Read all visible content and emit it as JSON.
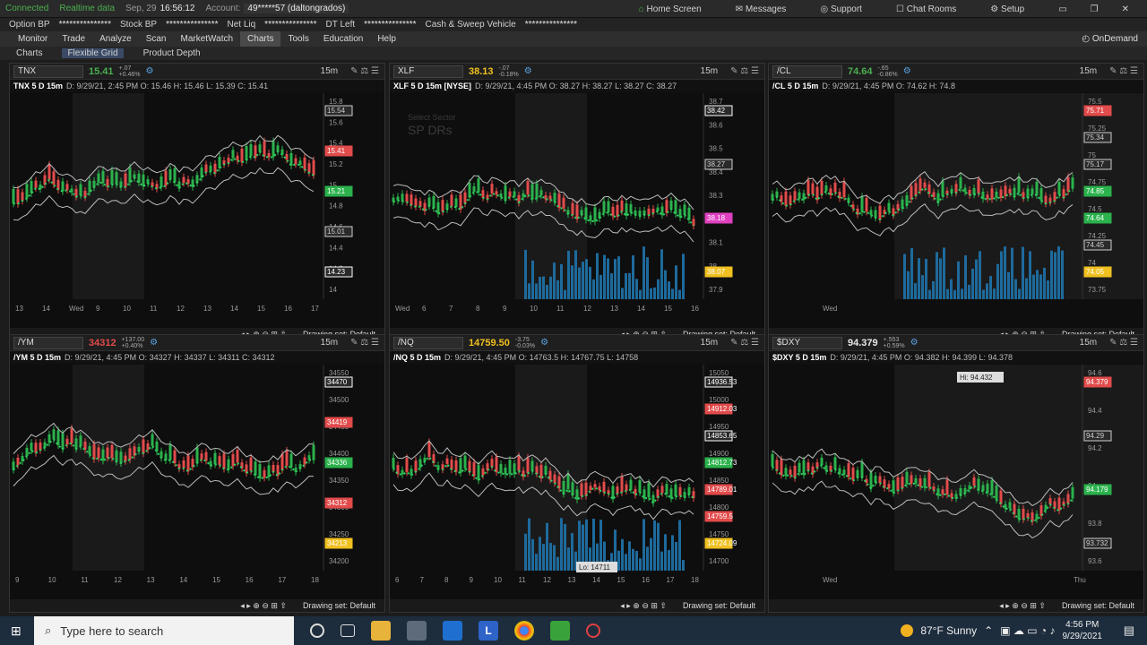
{
  "topbar": {
    "connected": "Connected",
    "realtime": "Realtime data",
    "date": "Sep, 29",
    "time": "16:56:12",
    "account_label": "Account:",
    "account": "49*****57 (daltongrados)",
    "home": "Home Screen",
    "messages": "Messages",
    "support": "Support",
    "chat": "Chat Rooms",
    "setup": "Setup"
  },
  "infobar": {
    "option_bp": "Option BP",
    "option_val": "***************",
    "stock_bp": "Stock BP",
    "stock_val": "***************",
    "net_liq": "Net Liq",
    "net_val": "***************",
    "dt_left": "DT Left",
    "dt_val": "***************",
    "sweep": "Cash & Sweep Vehicle",
    "sweep_val": "***************"
  },
  "nav": [
    "Monitor",
    "Trade",
    "Analyze",
    "Scan",
    "MarketWatch",
    "Charts",
    "Tools",
    "Education",
    "Help"
  ],
  "ondemand": "OnDemand",
  "subnav": [
    "Charts",
    "Flexible Grid",
    "Product Depth"
  ],
  "panels": [
    {
      "symbol": "TNX",
      "price": "15.41",
      "price_color": "#4caf50",
      "chg1": "+.07",
      "chg2": "+0.46%",
      "tf": "15m",
      "title": "TNX 5 D 15m",
      "ohlc": "D: 9/29/21, 2:45 PM  O: 15.46  H: 15.46  L: 15.39  C: 15.41",
      "footer": "Drawing set: Default",
      "x_labels": [
        "13",
        "14",
        "Wed",
        "9",
        "10",
        "11",
        "12",
        "13",
        "14",
        "15",
        "16",
        "17"
      ],
      "y_labels": [
        "15.8",
        "15.6",
        "15.4",
        "15.2",
        "15",
        "14.8",
        "14.6",
        "14.4",
        "14.2",
        "14"
      ],
      "tags": [
        {
          "t": "15.54",
          "c": "#cfcfcf"
        },
        {
          "t": "15.41",
          "c": "#e24b4b"
        },
        {
          "t": "15.21",
          "c": "#2bb24c"
        },
        {
          "t": "15.01",
          "c": "#cfcfcf"
        },
        {
          "t": "14.23",
          "c": "#ffffff"
        }
      ]
    },
    {
      "symbol": "XLF",
      "price": "38.13",
      "price_color": "#f0c020",
      "chg1": "-.07",
      "chg2": "-0.18%",
      "tf": "15m",
      "title": "XLF 5 D 15m [NYSE]",
      "ohlc": "D: 9/29/21, 4:45 PM  O: 38.27  H: 38.27  L: 38.27  C: 38.27",
      "watermark1": "Select Sector",
      "watermark2": "SP DRs",
      "footer": "Drawing set: Default",
      "x_labels": [
        "Wed",
        "6",
        "7",
        "8",
        "9",
        "10",
        "11",
        "12",
        "13",
        "14",
        "15",
        "16"
      ],
      "y_labels": [
        "38.7",
        "38.6",
        "38.5",
        "38.4",
        "38.3",
        "38.2",
        "38.1",
        "38",
        "37.9"
      ],
      "tags": [
        {
          "t": "38.42",
          "c": "#ffffff"
        },
        {
          "t": "38.27",
          "c": "#cfcfcf"
        },
        {
          "t": "38.18",
          "c": "#e040c0"
        },
        {
          "t": "38.07",
          "c": "#f0c020"
        }
      ]
    },
    {
      "symbol": "/CL",
      "price": "74.64",
      "price_color": "#4caf50",
      "chg1": "-.65",
      "chg2": "-0.86%",
      "tf": "15m",
      "title": "/CL 5 D 15m",
      "ohlc": "D: 9/29/21, 4:45 PM  O: 74.62  H: 74.8",
      "footer": "Drawing set: Default",
      "x_labels": [
        "Wed"
      ],
      "y_labels": [
        "75.5",
        "75.25",
        "75",
        "74.75",
        "74.5",
        "74.25",
        "74",
        "73.75"
      ],
      "tags": [
        {
          "t": "75.71",
          "c": "#e24b4b"
        },
        {
          "t": "75.34",
          "c": "#cfcfcf"
        },
        {
          "t": "75.17",
          "c": "#cfcfcf"
        },
        {
          "t": "74.85",
          "c": "#2bb24c"
        },
        {
          "t": "74.64",
          "c": "#2bb24c"
        },
        {
          "t": "74.45",
          "c": "#cfcfcf"
        },
        {
          "t": "74.05",
          "c": "#f0c020"
        }
      ]
    },
    {
      "symbol": "/YM",
      "price": "34312",
      "price_color": "#e24b4b",
      "chg1": "+137.00",
      "chg2": "+0.40%",
      "tf": "15m",
      "title": "/YM 5 D 15m",
      "ohlc": "D: 9/29/21, 4:45 PM  O: 34327  H: 34337  L: 34311  C: 34312",
      "footer": "Drawing set: Default",
      "x_labels": [
        "9",
        "10",
        "11",
        "12",
        "13",
        "14",
        "15",
        "16",
        "17",
        "18"
      ],
      "y_labels": [
        "34550",
        "34500",
        "34450",
        "34400",
        "34350",
        "34300",
        "34250",
        "34200"
      ],
      "tags": [
        {
          "t": "34470",
          "c": "#ffffff"
        },
        {
          "t": "34419",
          "c": "#e24b4b"
        },
        {
          "t": "34336",
          "c": "#2bb24c"
        },
        {
          "t": "34312",
          "c": "#e24b4b"
        },
        {
          "t": "34213",
          "c": "#f0c020"
        }
      ]
    },
    {
      "symbol": "/NQ",
      "price": "14759.50",
      "price_color": "#f0c020",
      "chg1": "-3.75",
      "chg2": "-0.03%",
      "tf": "15m",
      "title": "/NQ 5 D 15m",
      "ohlc": "D: 9/29/21, 4:45 PM  O: 14763.5  H: 14767.75  L: 14758",
      "lo_label": "Lo: 14711",
      "footer": "Drawing set: Default",
      "x_labels": [
        "6",
        "7",
        "8",
        "9",
        "10",
        "11",
        "12",
        "13",
        "14",
        "15",
        "16",
        "17",
        "18"
      ],
      "y_labels": [
        "15050",
        "15000",
        "14950",
        "14900",
        "14850",
        "14800",
        "14750",
        "14700"
      ],
      "tags": [
        {
          "t": "14936.53",
          "c": "#ffffff"
        },
        {
          "t": "14912.03",
          "c": "#e24b4b"
        },
        {
          "t": "14853.65",
          "c": "#ffffff"
        },
        {
          "t": "14812.73",
          "c": "#2bb24c"
        },
        {
          "t": "14789.01",
          "c": "#e24b4b"
        },
        {
          "t": "14759.5",
          "c": "#e24b4b"
        },
        {
          "t": "14724.09",
          "c": "#f0c020"
        }
      ]
    },
    {
      "symbol": "$DXY",
      "price": "94.379",
      "price_color": "#e8e8e8",
      "chg1": "+.553",
      "chg2": "+0.59%",
      "tf": "15m",
      "title": "$DXY 5 D 15m",
      "ohlc": "D: 9/29/21, 4:45 PM  O: 94.382  H: 94.399  L: 94.378",
      "hi_label": "Hi: 94.432",
      "footer": "Drawing set: Default",
      "x_labels": [
        "Wed",
        "Thu"
      ],
      "y_labels": [
        "94.6",
        "94.4",
        "94.2",
        "94",
        "93.8",
        "93.6"
      ],
      "tags": [
        {
          "t": "94.379",
          "c": "#e24b4b"
        },
        {
          "t": "94.29",
          "c": "#cfcfcf"
        },
        {
          "t": "94.179",
          "c": "#2bb24c"
        },
        {
          "t": "93.732",
          "c": "#cfcfcf"
        }
      ]
    }
  ],
  "taskbar": {
    "search_placeholder": "Type here to search",
    "weather": "87°F  Sunny",
    "time": "4:56 PM",
    "date": "9/29/2021"
  }
}
